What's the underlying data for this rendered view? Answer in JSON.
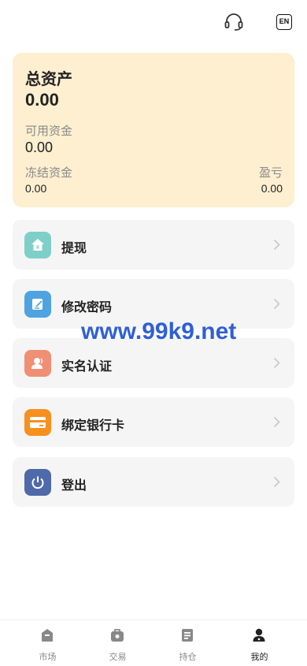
{
  "header": {
    "support_icon": "headset-icon",
    "lang_label": "EN"
  },
  "assets": {
    "title": "总资产",
    "total": "0.00",
    "available_label": "可用资金",
    "available_value": "0.00",
    "frozen_label": "冻结资金",
    "frozen_value": "0.00",
    "pnl_label": "盈亏",
    "pnl_value": "0.00",
    "card_color": "#fdefcf"
  },
  "menu": [
    {
      "label": "提现",
      "icon": "withdraw-icon",
      "color": "#7fcfc9"
    },
    {
      "label": "修改密码",
      "icon": "edit-password-icon",
      "color": "#4ea3e0"
    },
    {
      "label": "实名认证",
      "icon": "user-verify-icon",
      "color": "#f08f74"
    },
    {
      "label": "绑定银行卡",
      "icon": "bank-card-icon",
      "color": "#f7901e"
    },
    {
      "label": "登出",
      "icon": "power-icon",
      "color": "#4f6aa8"
    }
  ],
  "watermark": "www.99k9.net",
  "tabbar": {
    "items": [
      {
        "label": "市场",
        "icon": "market-icon"
      },
      {
        "label": "交易",
        "icon": "trade-icon"
      },
      {
        "label": "持仓",
        "icon": "position-icon"
      },
      {
        "label": "我的",
        "icon": "profile-icon",
        "active": true
      }
    ]
  }
}
